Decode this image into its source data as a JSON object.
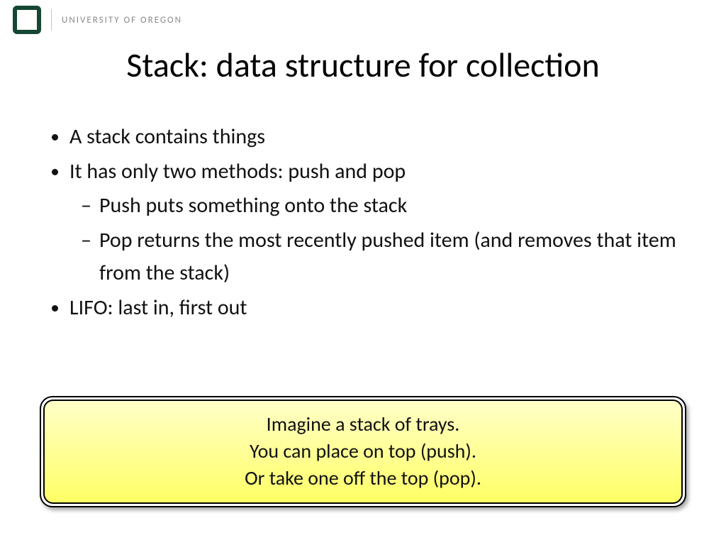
{
  "header": {
    "institution": "UNIVERSITY OF OREGON"
  },
  "title": "Stack: data structure for collection",
  "bullets": {
    "b1": "A stack contains things",
    "b2": "It has only two methods: push and pop",
    "b2a": "Push puts something onto the stack",
    "b2b": "Pop returns the most recently pushed item (and removes that item from the stack)",
    "b3": "LIFO: last in, first out"
  },
  "callout": {
    "line1": "Imagine a stack of trays.",
    "line2": "You can place on top (push).",
    "line3": "Or take one off the top (pop)."
  }
}
